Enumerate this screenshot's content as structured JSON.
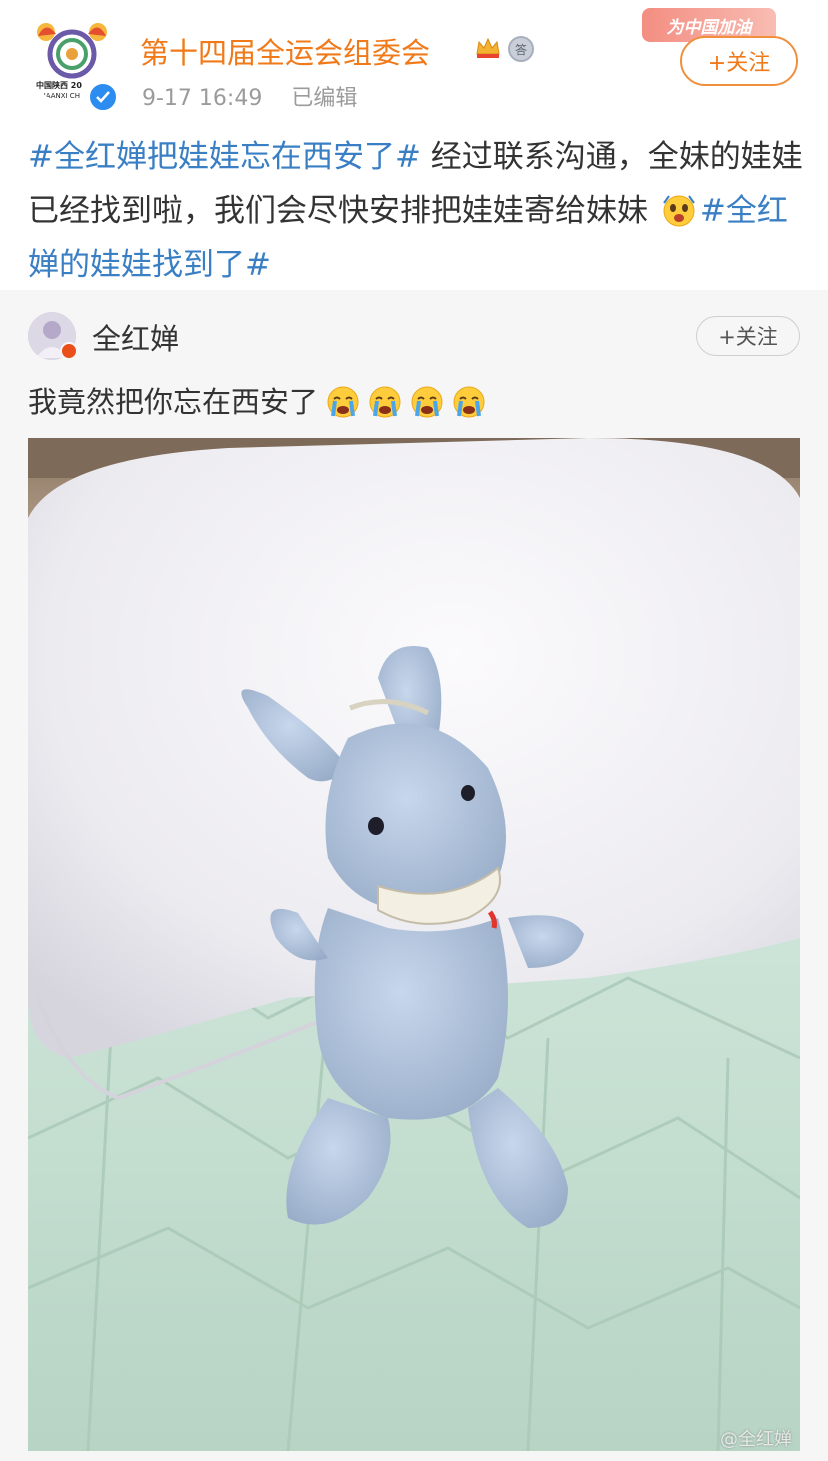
{
  "post": {
    "author": "第十四届全运会组委会",
    "timestamp": "9-17 16:49",
    "edited": "已编辑",
    "promo": "为中国加油",
    "follow": "+关注",
    "topic1": "#全红婵把娃娃忘在西安了#",
    "text1": " 经过联系沟通，全妹的娃娃已经找到啦，我们会尽快安排把娃娃寄给妹妹 ",
    "topic2": "#全红婵的娃娃找到了#",
    "logo_text": "中国陕西 20",
    "logo_subtext": "SHAANXI CH",
    "medal_glyph": "答"
  },
  "repost": {
    "author": "全红婵",
    "follow": "+关注",
    "text": "我竟然把你忘在西安了",
    "cry_count": 4,
    "watermark": "@全红婵"
  },
  "colors": {
    "brand_orange": "#f07a1a",
    "topic_blue": "#3a7fc4",
    "repost_bg": "#f6f6f6"
  },
  "icons": {
    "verified": "verified-check-icon",
    "vip": "crown-vip-icon",
    "medal": "medal-icon",
    "emoji_post": "surprised-face-emoji-icon",
    "emoji_repost": "crying-face-emoji-icon"
  }
}
